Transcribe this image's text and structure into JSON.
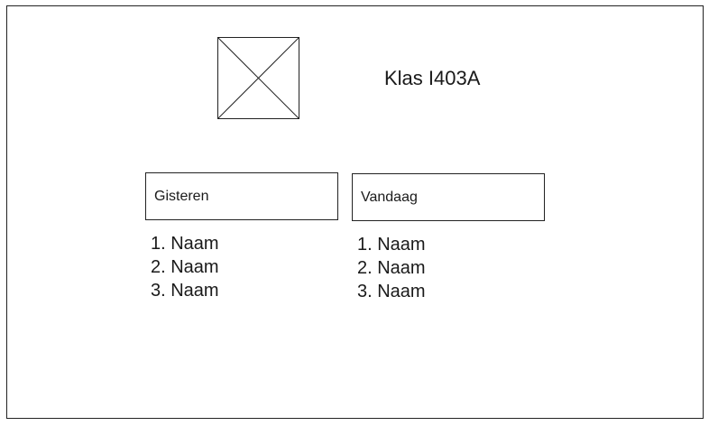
{
  "page": {
    "title": "Klas I403A",
    "image_placeholder": "image-placeholder"
  },
  "columns": {
    "yesterday": {
      "label": "Gisteren",
      "items": [
        "1. Naam",
        "2. Naam",
        "3. Naam"
      ]
    },
    "today": {
      "label": "Vandaag",
      "items": [
        "1. Naam",
        "2. Naam",
        "3. Naam"
      ]
    }
  },
  "colors": {
    "border": "#222222",
    "text": "#1a1a1a",
    "background": "#ffffff"
  }
}
